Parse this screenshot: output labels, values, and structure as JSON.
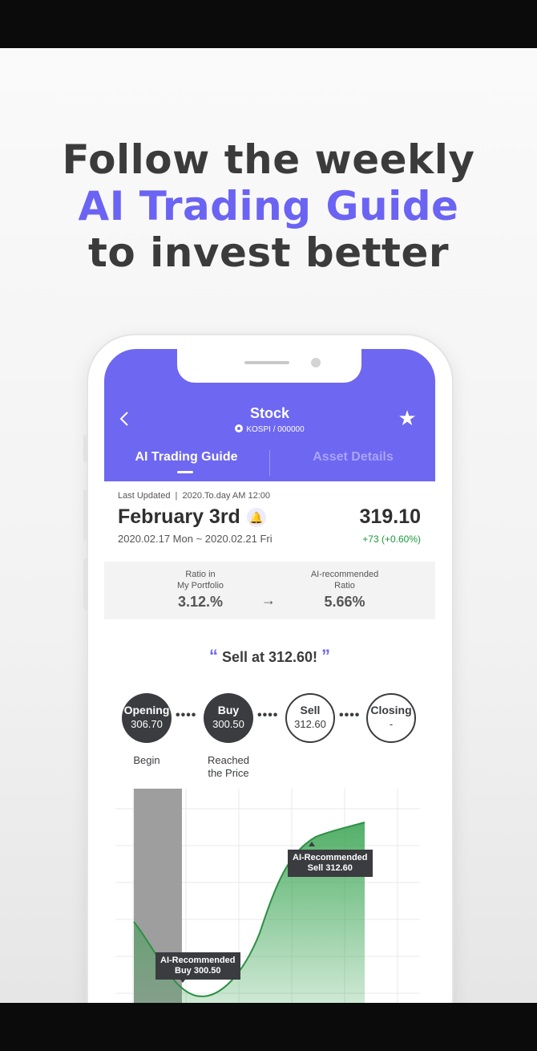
{
  "headline": {
    "line1": "Follow the weekly",
    "line2": "AI Trading Guide",
    "line3": "to invest better"
  },
  "colors": {
    "accent": "#6e67f1",
    "positive": "#1a9a3a",
    "dark": "#3a3c40"
  },
  "app": {
    "title": "Stock",
    "subtitle": "KOSPI / 000000",
    "back_icon": "chevron-left-icon",
    "favorite_icon": "star-icon",
    "tabs": [
      {
        "label": "AI Trading Guide",
        "active": true
      },
      {
        "label": "Asset Details",
        "active": false
      }
    ]
  },
  "info": {
    "last_updated": "Last Updated  |  2020.To.day AM 12:00",
    "date": "February 3rd",
    "bell_icon": "bell-icon",
    "range": "2020.02.17 Mon ~ 2020.02.21 Fri",
    "price": "319.10",
    "change": "+73 (+0.60%)"
  },
  "ratio": {
    "portfolio_label_1": "Ratio in",
    "portfolio_label_2": "My Portfolio",
    "portfolio_value": "3.12.%",
    "recommended_label_1": "AI-recommended",
    "recommended_label_2": "Ratio",
    "recommended_value": "5.66%",
    "arrow": "→"
  },
  "quote": {
    "open": "“",
    "text": "Sell at 312.60!",
    "close": "”"
  },
  "steps": [
    {
      "label": "Opening",
      "value": "306.70",
      "caption_1": "Begin",
      "caption_2": ""
    },
    {
      "label": "Buy",
      "value": "300.50",
      "caption_1": "Reached",
      "caption_2": "the Price"
    },
    {
      "label": "Sell",
      "value": "312.60",
      "caption_1": "",
      "caption_2": ""
    },
    {
      "label": "Closing",
      "value": "-",
      "caption_1": "",
      "caption_2": ""
    }
  ],
  "chart": {
    "buy_tooltip_1": "AI-Recommended",
    "buy_tooltip_2": "Buy 300.50",
    "sell_tooltip_1": "AI-Recommended",
    "sell_tooltip_2": "Sell 312.60"
  }
}
